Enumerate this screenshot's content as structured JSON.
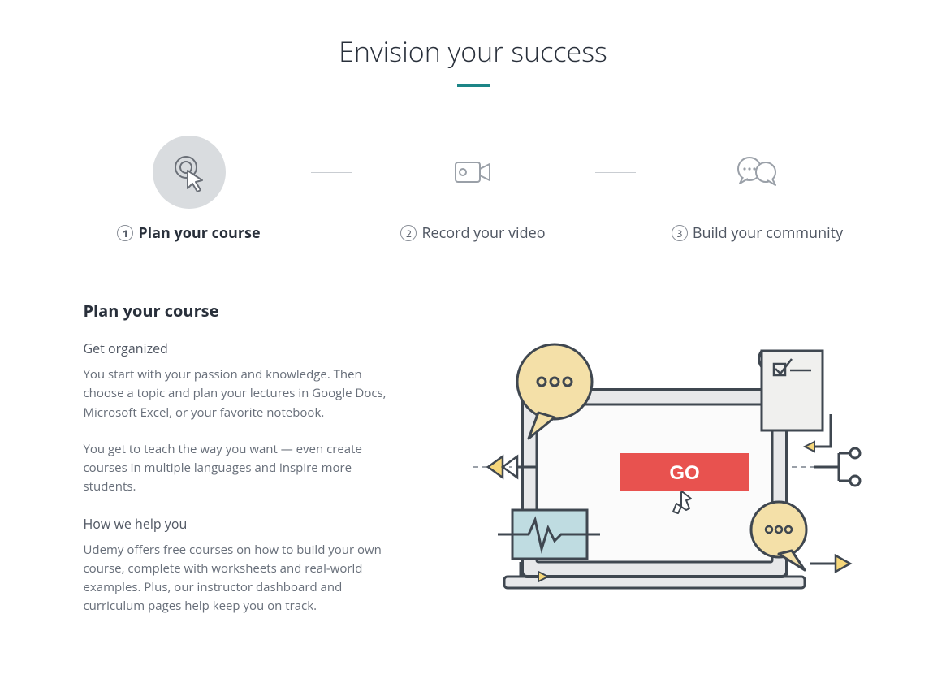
{
  "title": "Envision your success",
  "steps": [
    {
      "num": "1",
      "label": "Plan your course"
    },
    {
      "num": "2",
      "label": "Record your video"
    },
    {
      "num": "3",
      "label": "Build your community"
    }
  ],
  "detail": {
    "heading": "Plan your course",
    "sub1": "Get organized",
    "p1": "You start with your passion and knowledge. Then choose a topic and plan your lectures in Google Docs, Microsoft Excel, or your favorite notebook.",
    "p2": "You get to teach the way you want — even create courses in multiple languages and inspire more students.",
    "sub2": "How we help you",
    "p3": "Udemy offers free courses on how to build your own course, complete with worksheets and real-world examples. Plus, our instructor dashboard and curriculum pages help keep you on track."
  },
  "illustration": {
    "button_text": "GO"
  }
}
